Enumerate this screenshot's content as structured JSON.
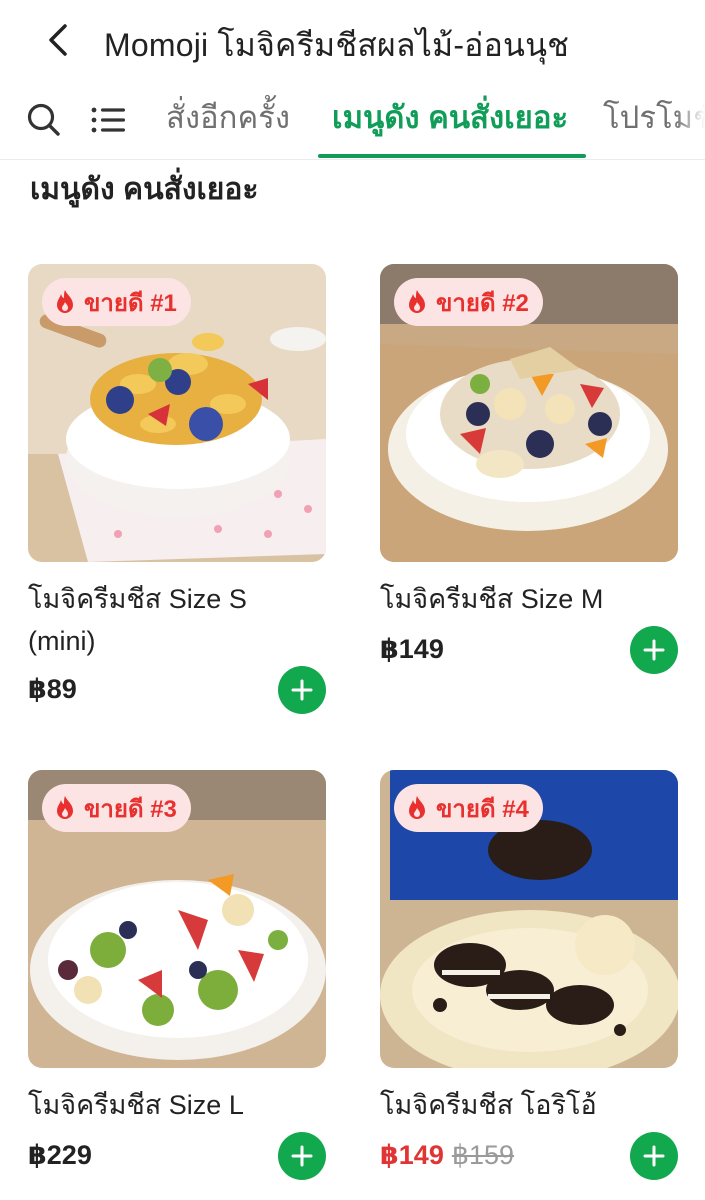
{
  "header": {
    "title": "Momoji โมจิครีมชีสผลไม้-อ่อนนุช",
    "back_icon": "chevron-left-icon"
  },
  "tabs": {
    "search_icon": "search-icon",
    "list_icon": "list-icon",
    "items": [
      {
        "label": "สั่งอีกครั้ง",
        "active": false
      },
      {
        "label": "เมนูดัง คนสั่งเยอะ",
        "active": true
      },
      {
        "label": "โปรโมชั่น",
        "active": false
      }
    ]
  },
  "section": {
    "title": "เมนูดัง คนสั่งเยอะ"
  },
  "colors": {
    "accent": "#0f9d58",
    "add_button": "#12a84e",
    "badge_bg": "#fde4e4",
    "badge_text": "#e8312f",
    "sale_price": "#e03535"
  },
  "products": [
    {
      "badge": "ขายดี #1",
      "name": "โมจิครีมชีส Size S (mini)",
      "price": "฿89",
      "old_price": ""
    },
    {
      "badge": "ขายดี #2",
      "name": "โมจิครีมชีส Size M",
      "price": "฿149",
      "old_price": ""
    },
    {
      "badge": "ขายดี #3",
      "name": "โมจิครีมชีส Size L",
      "price": "฿229",
      "old_price": ""
    },
    {
      "badge": "ขายดี #4",
      "name": "โมจิครีมชีส โอริโอ้",
      "price": "฿149",
      "old_price": "฿159"
    }
  ]
}
